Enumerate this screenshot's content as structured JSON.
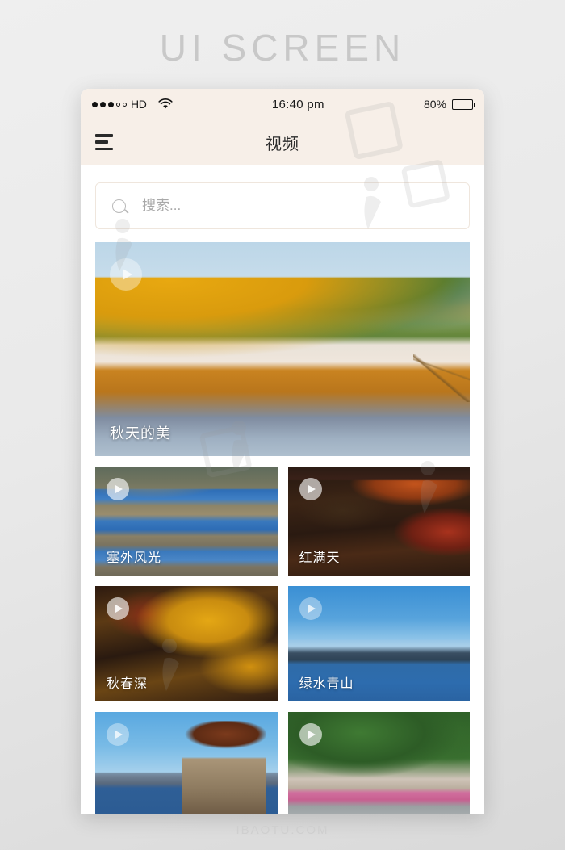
{
  "page": {
    "title": "UI SCREEN",
    "footer": "IBAOTU.COM"
  },
  "phone": {
    "status_bar": {
      "carrier_label": "HD",
      "signal_dots_filled": 3,
      "signal_dots_empty": 2,
      "wifi_icon": "wifi-icon",
      "time": "16:40 pm",
      "battery_percent": "80%",
      "battery_level": 80
    },
    "nav_bar": {
      "menu_icon": "hamburger-menu-icon",
      "title": "视频"
    },
    "search": {
      "icon": "search-icon",
      "placeholder": "搜索...",
      "value": ""
    },
    "videos": [
      {
        "title": "秋天的美",
        "size": "full",
        "scene": "sc-autumn-river",
        "play_icon": "play-icon",
        "play_style": "dim"
      },
      {
        "title": "塞外风光",
        "size": "half",
        "scene": "sc-river-blue",
        "play_icon": "play-icon",
        "play_style": "normal"
      },
      {
        "title": "红满天",
        "size": "half",
        "scene": "sc-red-forest",
        "play_icon": "play-icon",
        "play_style": "normal"
      },
      {
        "title": "秋春深",
        "size": "half tall",
        "scene": "sc-gold-forest",
        "play_icon": "play-icon",
        "play_style": "normal"
      },
      {
        "title": "绿水青山",
        "size": "half tall",
        "scene": "sc-lake-mountain",
        "play_icon": "play-icon",
        "play_style": "dim"
      },
      {
        "title": "",
        "size": "half tall",
        "scene": "sc-bridge-pavilion",
        "play_icon": "play-icon",
        "play_style": "dim"
      },
      {
        "title": "",
        "size": "half tall",
        "scene": "sc-village",
        "play_icon": "play-icon",
        "play_style": "normal"
      }
    ]
  },
  "colors": {
    "header_bg": "#f7efe8",
    "content_bg": "#ffffff",
    "page_bg": "#e9e9e9",
    "title_text": "#c8c8c8",
    "nav_text": "#2b2b2b",
    "placeholder_text": "#a8a8a8",
    "card_title_text": "#ffffff"
  }
}
